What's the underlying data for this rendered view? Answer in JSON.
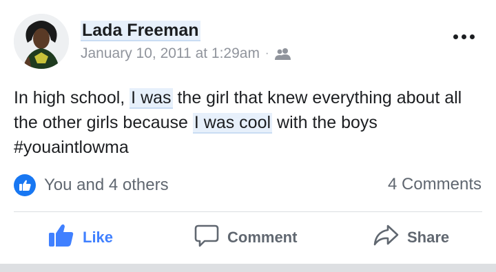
{
  "post": {
    "author": "Lada Freeman",
    "date": "January 10, 2011 at 1:29am",
    "separator": "·",
    "audience_icon": "friends-icon",
    "more_icon": "ellipsis-icon",
    "body": {
      "part1": "In high school, ",
      "hl1": "I was",
      "part2": " the girl that knew everything about all the other girls because ",
      "hl2": "I was cool",
      "part3": " with the boys #youaintlowma"
    }
  },
  "reactions": {
    "icon": "thumbs-up-icon",
    "label": "You and 4 others"
  },
  "comments": {
    "count_label": "4 Comments"
  },
  "actions": {
    "like_label": "Like",
    "comment_label": "Comment",
    "share_label": "Share"
  },
  "colors": {
    "accent": "#4080ff",
    "reaction_badge": "#1877f2",
    "secondary_text": "#606770",
    "meta_text": "#90949c",
    "highlight_bg": "#e7f0fb"
  }
}
